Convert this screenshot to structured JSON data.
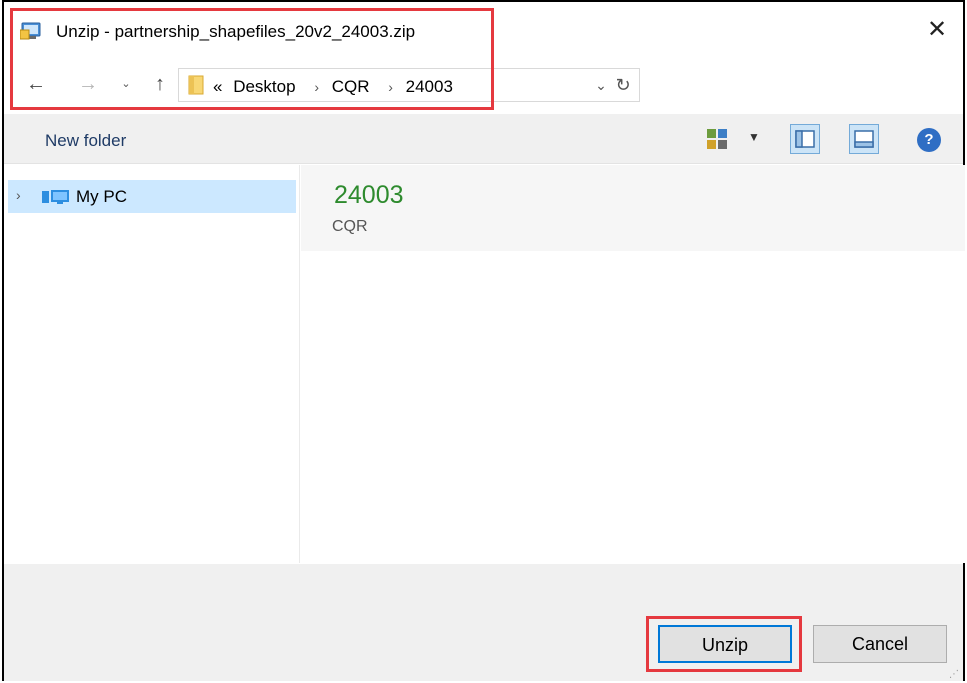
{
  "window": {
    "title": "Unzip - partnership_shapefiles_20v2_24003.zip",
    "close_glyph": "✕"
  },
  "nav": {
    "back_glyph": "←",
    "forward_glyph": "→",
    "recent_glyph": "⌄",
    "up_glyph": "↑"
  },
  "address": {
    "overflow": "«",
    "crumbs": [
      "Desktop",
      "CQR",
      "24003"
    ],
    "separator": "›",
    "dropdown_glyph": "⌄",
    "refresh_glyph": "↻"
  },
  "toolbar": {
    "new_folder_label": "New folder",
    "views_dropdown_glyph": "▼",
    "help_glyph": "?"
  },
  "tree": {
    "items": [
      {
        "label": "My PC",
        "expand_glyph": "›",
        "icon": "computer-icon",
        "selected": true
      }
    ]
  },
  "content": {
    "folder_name": "24003",
    "parent_name": "CQR",
    "folder_name_color": "#2e8b2e"
  },
  "buttons": {
    "unzip_label": "Unzip",
    "cancel_label": "Cancel"
  },
  "colors": {
    "highlight": "#e5393f",
    "selection": "#cce8ff",
    "accent": "#0078d7"
  },
  "icons": {
    "title": "zip-extract-icon",
    "folder": "folder-icon",
    "views": "change-view-icon",
    "preview_pane": "preview-pane-icon",
    "details_pane": "details-pane-icon",
    "help": "help-icon"
  }
}
